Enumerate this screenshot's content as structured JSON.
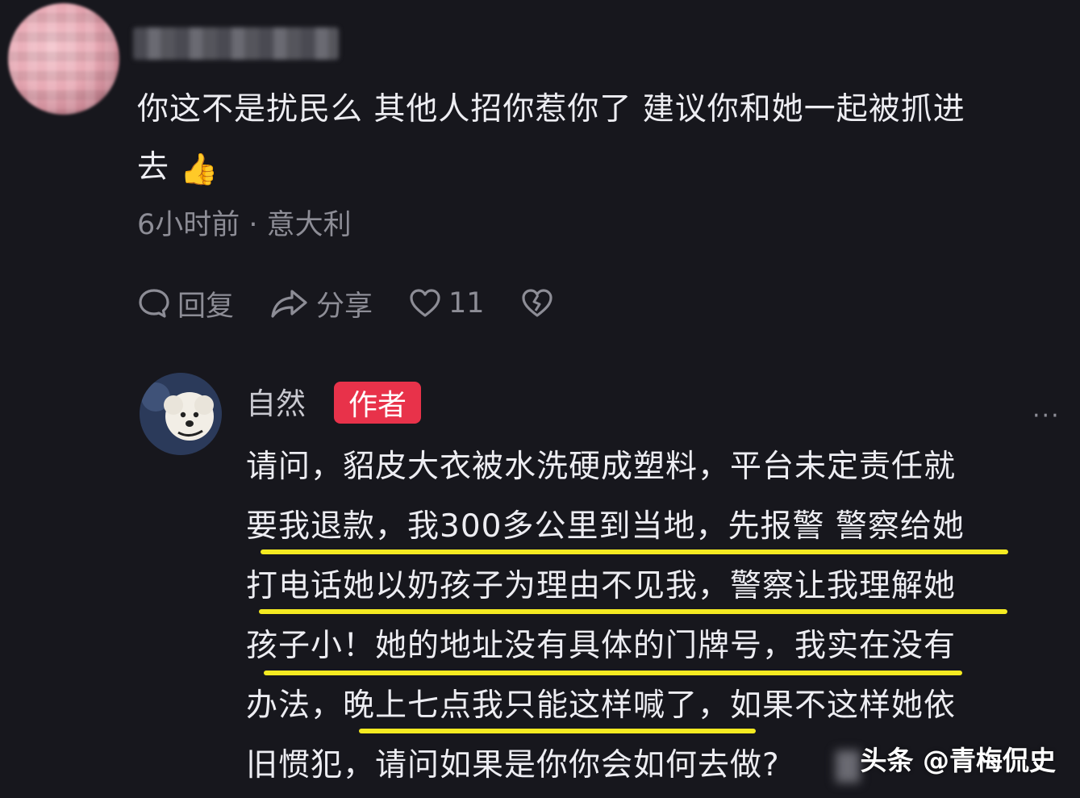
{
  "comment": {
    "text_line1": "你这不是扰民么  其他人招你惹你了 建议你和她一起被抓进",
    "text_line2": "去",
    "emoji": "👍",
    "time": "6小时前",
    "location": "意大利",
    "meta_sep": " · ",
    "actions": {
      "reply": "回复",
      "share": "分享",
      "likes": "11"
    }
  },
  "reply": {
    "author": "自然",
    "badge": "作者",
    "more": "···",
    "lines": [
      "请问，貂皮大衣被水洗硬成塑料，平台未定责任就",
      "要我退款，我300多公里到当地，先报警 警察给她",
      "打电话她以奶孩子为理由不见我，警察让我理解她",
      "孩子小！她的地址没有具体的门牌号，我实在没有",
      "办法，晚上七点我只能这样喊了，如果不这样她依",
      "旧惯犯，请问如果是你你会如何去做?"
    ]
  },
  "watermark": "头条 @青梅侃史",
  "colors": {
    "background": "#17171d",
    "highlight": "#f4ea21",
    "badge": "#e8324a",
    "muted": "#8d8d96"
  }
}
